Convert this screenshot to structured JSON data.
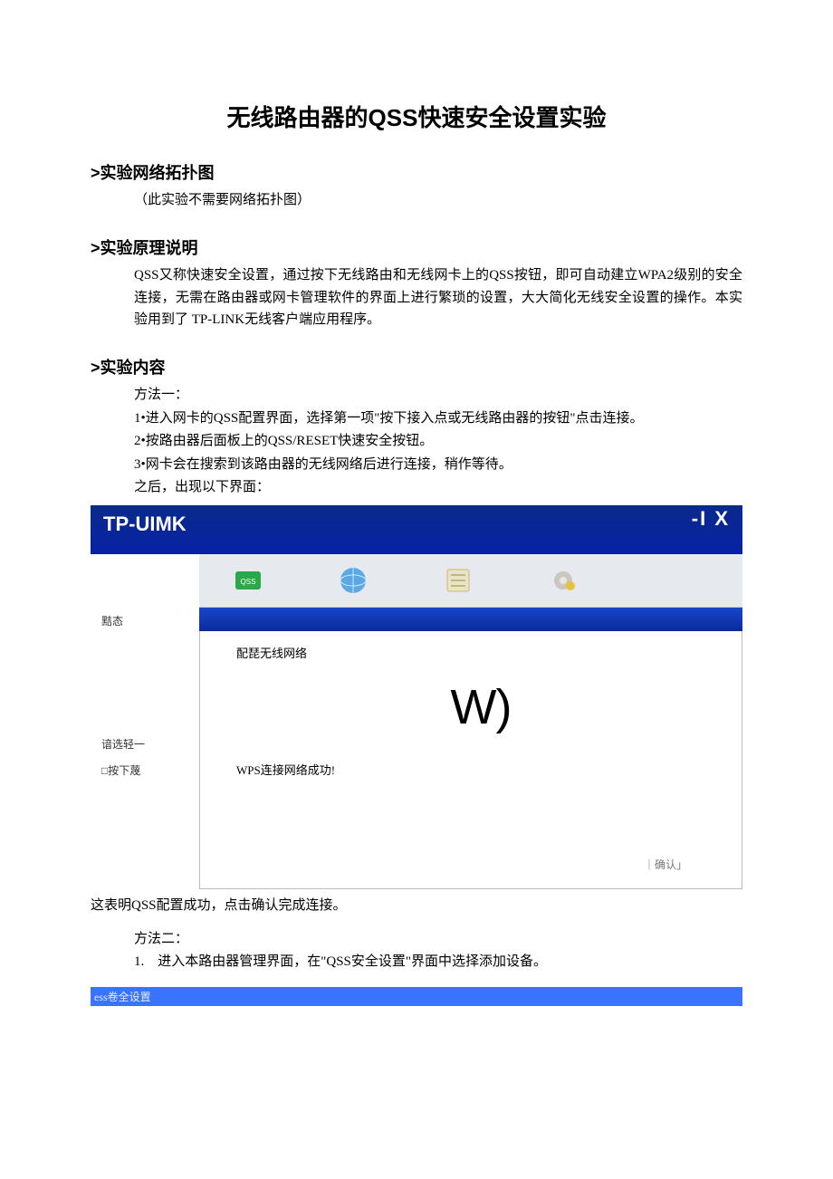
{
  "title": "无线路由器的QSS快速安全设置实验",
  "sec1": {
    "head": ">实验网络拓扑图",
    "line": "（此实验不需要网络拓扑图）"
  },
  "sec2": {
    "head": ">实验原理说明",
    "body": "QSS又称快速安全设置，通过按下无线路由和无线网卡上的QSS按钮，即可自动建立WPA2级别的安全连接，无需在路由器或网卡管理软件的界面上进行繁琐的设置，大大简化无线安全设置的操作。本实验用到了 TP-LINK无线客户端应用程序。"
  },
  "sec3": {
    "head": ">实验内容",
    "m1": "方法一：",
    "s1": "1•进入网卡的QSS配置界面，选择第一项\"按下接入点或无线路由器的按钮\"点击连接。",
    "s2": "2•按路由器后面板上的QSS/RESET快速安全按钮。",
    "s3": "3•网卡会在搜索到该路由器的无线网络后进行连接，稍作等待。",
    "s4": "之后，出现以下界面："
  },
  "app": {
    "brand": "TP-UIMK",
    "winbtns": "-I X",
    "side": {
      "a": "黠态",
      "b": "谙选轻一",
      "c": "□按下蔑"
    },
    "panel": {
      "title": "配琵无线网络",
      "bigw": "W)",
      "msg": "WPS连接网络成功!",
      "btn": "｜确认」"
    }
  },
  "post": "这表明QSS配置成功，点击确认完成连接。",
  "m2": {
    "label": "方法二：",
    "step": "1.　进入本路由器管理界面，在\"QSS安全设置\"界面中选择添加设备。"
  },
  "bluebar": "ess卷全设置"
}
